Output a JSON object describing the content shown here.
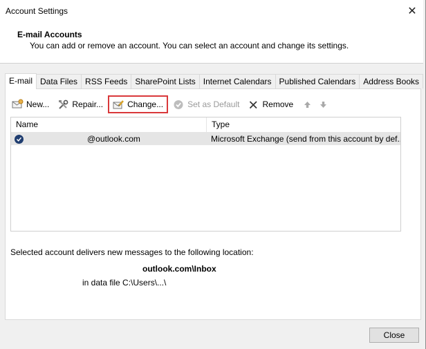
{
  "window": {
    "title": "Account Settings"
  },
  "header": {
    "title": "E-mail Accounts",
    "subtitle": "You can add or remove an account. You can select an account and change its settings."
  },
  "tabs": [
    {
      "label": "E-mail",
      "active": true
    },
    {
      "label": "Data Files"
    },
    {
      "label": "RSS Feeds"
    },
    {
      "label": "SharePoint Lists"
    },
    {
      "label": "Internet Calendars"
    },
    {
      "label": "Published Calendars"
    },
    {
      "label": "Address Books"
    }
  ],
  "toolbar": {
    "new_label": "New...",
    "repair_label": "Repair...",
    "change_label": "Change...",
    "set_default_label": "Set as Default",
    "remove_label": "Remove"
  },
  "list": {
    "columns": {
      "name": "Name",
      "type": "Type"
    },
    "rows": [
      {
        "name": "@outlook.com",
        "type": "Microsoft Exchange (send from this account by def..."
      }
    ]
  },
  "location": {
    "intro": "Selected account delivers new messages to the following location:",
    "folder": "outlook.com\\Inbox",
    "file": "in data file C:\\Users\\...\\"
  },
  "footer": {
    "close_label": "Close"
  },
  "colors": {
    "highlight": "#d9383a",
    "selection": "#e5e5e5",
    "default_badge": "#1f3d70"
  }
}
